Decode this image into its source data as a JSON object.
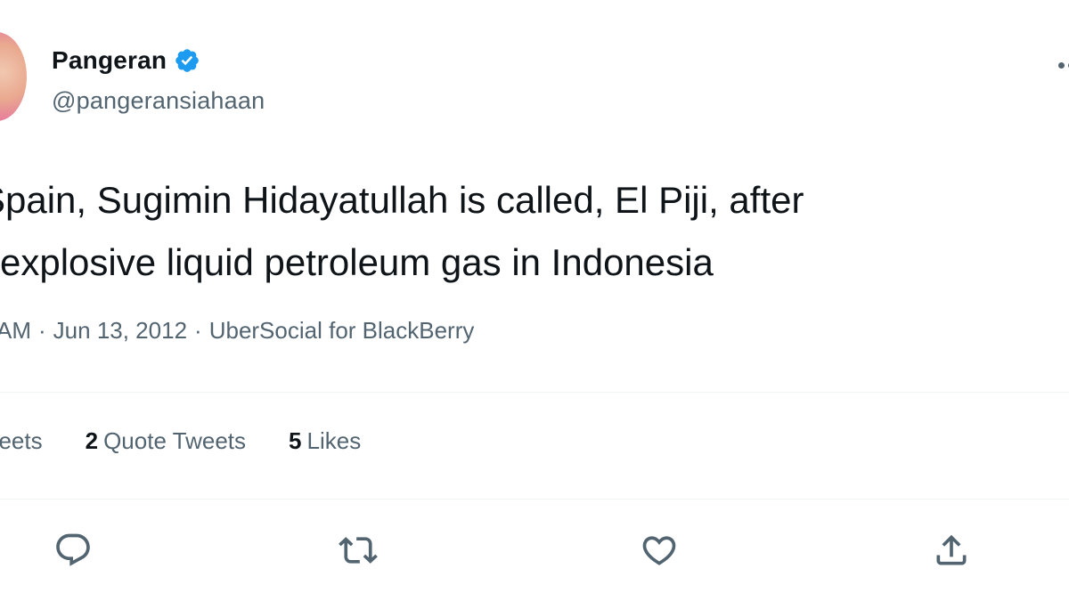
{
  "user": {
    "display_name": "Pangeran",
    "handle": "@pangeransiahaan",
    "verified": true
  },
  "tweet": {
    "lines": [
      "Spain, Sugimin Hidayatullah is called, El Piji, after",
      "explosive liquid petroleum gas in Indonesia"
    ]
  },
  "meta": {
    "time": "AM",
    "date": "Jun 13, 2012",
    "source": "UberSocial for BlackBerry",
    "separator": "·"
  },
  "stats": {
    "retweets_label": "etweets",
    "quote_count": "2",
    "quote_label": "Quote Tweets",
    "likes_count": "5",
    "likes_label": "Likes"
  },
  "actions": [
    "reply-icon",
    "retweet-icon",
    "like-icon",
    "share-icon"
  ],
  "colors": {
    "text": "#0f1419",
    "secondary": "#536471",
    "verified": "#1d9bf0",
    "divider": "#eff3f4"
  }
}
